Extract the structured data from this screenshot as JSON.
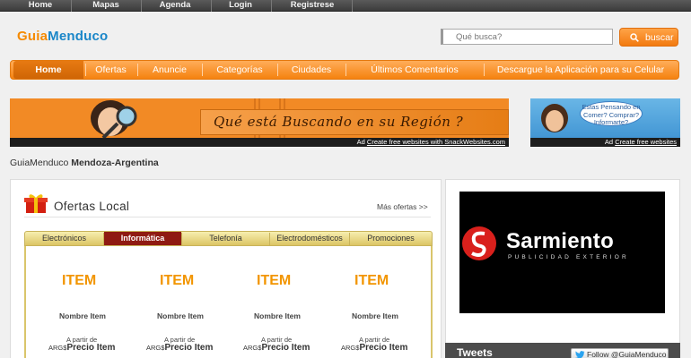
{
  "topnav": [
    "Home",
    "Mapas",
    "Agenda",
    "Login",
    "Registrese"
  ],
  "logo": {
    "part1": "Guia",
    "part2": "Menduco"
  },
  "search": {
    "placeholder": "Qué busca?",
    "button": "buscar"
  },
  "nav": [
    "Home",
    "Ofertas",
    "Anuncie",
    "Categorías",
    "Ciudades",
    "Últimos Comentarios",
    "Descargue la Aplicación para su Celular"
  ],
  "banner_main": {
    "text": "Qué está Buscando en su Región ?",
    "ad_prefix": "Ad",
    "ad_link": "Create free websites with SnackWebsites.com"
  },
  "banner_side": {
    "bubble": "Estas Pensando en Comer? Comprar? Informarte?",
    "ad_prefix": "Ad",
    "ad_link": "Create free websites"
  },
  "location": {
    "site": "GuiaMenduco",
    "place": "Mendoza-Argentina"
  },
  "offers": {
    "title": "Ofertas Local",
    "more": "Más ofertas >>",
    "tabs": [
      "Electrónicos",
      "Informática",
      "Telefonía",
      "Electrodomésticos",
      "Promociones"
    ],
    "active_tab": "Informática",
    "items": [
      {
        "title": "ITEM",
        "name": "Nombre Item",
        "from": "A partir de",
        "currency": "ARG$",
        "price": "Precio Item"
      },
      {
        "title": "ITEM",
        "name": "Nombre Item",
        "from": "A partir de",
        "currency": "ARG$",
        "price": "Precio Item"
      },
      {
        "title": "ITEM",
        "name": "Nombre Item",
        "from": "A partir de",
        "currency": "ARG$",
        "price": "Precio Item"
      },
      {
        "title": "ITEM",
        "name": "Nombre Item",
        "from": "A partir de",
        "currency": "ARG$",
        "price": "Precio Item"
      }
    ]
  },
  "sponsor": {
    "name": "Sarmiento",
    "tagline": "PUBLICIDAD EXTERIOR"
  },
  "tweets": {
    "title": "Tweets",
    "follow": "Follow @GuiaMenduco"
  },
  "colors": {
    "accent": "#f5820f",
    "active_tab": "#8f1a12",
    "logo_blue": "#1a86c8"
  }
}
